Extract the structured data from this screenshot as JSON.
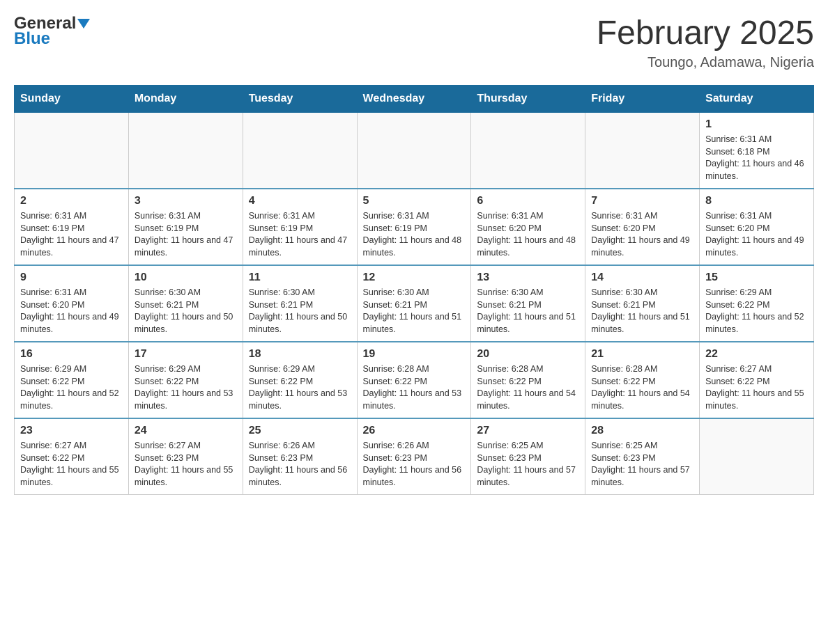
{
  "header": {
    "logo_general": "General",
    "logo_blue": "Blue",
    "month_title": "February 2025",
    "location": "Toungo, Adamawa, Nigeria"
  },
  "weekdays": [
    "Sunday",
    "Monday",
    "Tuesday",
    "Wednesday",
    "Thursday",
    "Friday",
    "Saturday"
  ],
  "weeks": [
    [
      {
        "day": "",
        "sunrise": "",
        "sunset": "",
        "daylight": ""
      },
      {
        "day": "",
        "sunrise": "",
        "sunset": "",
        "daylight": ""
      },
      {
        "day": "",
        "sunrise": "",
        "sunset": "",
        "daylight": ""
      },
      {
        "day": "",
        "sunrise": "",
        "sunset": "",
        "daylight": ""
      },
      {
        "day": "",
        "sunrise": "",
        "sunset": "",
        "daylight": ""
      },
      {
        "day": "",
        "sunrise": "",
        "sunset": "",
        "daylight": ""
      },
      {
        "day": "1",
        "sunrise": "Sunrise: 6:31 AM",
        "sunset": "Sunset: 6:18 PM",
        "daylight": "Daylight: 11 hours and 46 minutes."
      }
    ],
    [
      {
        "day": "2",
        "sunrise": "Sunrise: 6:31 AM",
        "sunset": "Sunset: 6:19 PM",
        "daylight": "Daylight: 11 hours and 47 minutes."
      },
      {
        "day": "3",
        "sunrise": "Sunrise: 6:31 AM",
        "sunset": "Sunset: 6:19 PM",
        "daylight": "Daylight: 11 hours and 47 minutes."
      },
      {
        "day": "4",
        "sunrise": "Sunrise: 6:31 AM",
        "sunset": "Sunset: 6:19 PM",
        "daylight": "Daylight: 11 hours and 47 minutes."
      },
      {
        "day": "5",
        "sunrise": "Sunrise: 6:31 AM",
        "sunset": "Sunset: 6:19 PM",
        "daylight": "Daylight: 11 hours and 48 minutes."
      },
      {
        "day": "6",
        "sunrise": "Sunrise: 6:31 AM",
        "sunset": "Sunset: 6:20 PM",
        "daylight": "Daylight: 11 hours and 48 minutes."
      },
      {
        "day": "7",
        "sunrise": "Sunrise: 6:31 AM",
        "sunset": "Sunset: 6:20 PM",
        "daylight": "Daylight: 11 hours and 49 minutes."
      },
      {
        "day": "8",
        "sunrise": "Sunrise: 6:31 AM",
        "sunset": "Sunset: 6:20 PM",
        "daylight": "Daylight: 11 hours and 49 minutes."
      }
    ],
    [
      {
        "day": "9",
        "sunrise": "Sunrise: 6:31 AM",
        "sunset": "Sunset: 6:20 PM",
        "daylight": "Daylight: 11 hours and 49 minutes."
      },
      {
        "day": "10",
        "sunrise": "Sunrise: 6:30 AM",
        "sunset": "Sunset: 6:21 PM",
        "daylight": "Daylight: 11 hours and 50 minutes."
      },
      {
        "day": "11",
        "sunrise": "Sunrise: 6:30 AM",
        "sunset": "Sunset: 6:21 PM",
        "daylight": "Daylight: 11 hours and 50 minutes."
      },
      {
        "day": "12",
        "sunrise": "Sunrise: 6:30 AM",
        "sunset": "Sunset: 6:21 PM",
        "daylight": "Daylight: 11 hours and 51 minutes."
      },
      {
        "day": "13",
        "sunrise": "Sunrise: 6:30 AM",
        "sunset": "Sunset: 6:21 PM",
        "daylight": "Daylight: 11 hours and 51 minutes."
      },
      {
        "day": "14",
        "sunrise": "Sunrise: 6:30 AM",
        "sunset": "Sunset: 6:21 PM",
        "daylight": "Daylight: 11 hours and 51 minutes."
      },
      {
        "day": "15",
        "sunrise": "Sunrise: 6:29 AM",
        "sunset": "Sunset: 6:22 PM",
        "daylight": "Daylight: 11 hours and 52 minutes."
      }
    ],
    [
      {
        "day": "16",
        "sunrise": "Sunrise: 6:29 AM",
        "sunset": "Sunset: 6:22 PM",
        "daylight": "Daylight: 11 hours and 52 minutes."
      },
      {
        "day": "17",
        "sunrise": "Sunrise: 6:29 AM",
        "sunset": "Sunset: 6:22 PM",
        "daylight": "Daylight: 11 hours and 53 minutes."
      },
      {
        "day": "18",
        "sunrise": "Sunrise: 6:29 AM",
        "sunset": "Sunset: 6:22 PM",
        "daylight": "Daylight: 11 hours and 53 minutes."
      },
      {
        "day": "19",
        "sunrise": "Sunrise: 6:28 AM",
        "sunset": "Sunset: 6:22 PM",
        "daylight": "Daylight: 11 hours and 53 minutes."
      },
      {
        "day": "20",
        "sunrise": "Sunrise: 6:28 AM",
        "sunset": "Sunset: 6:22 PM",
        "daylight": "Daylight: 11 hours and 54 minutes."
      },
      {
        "day": "21",
        "sunrise": "Sunrise: 6:28 AM",
        "sunset": "Sunset: 6:22 PM",
        "daylight": "Daylight: 11 hours and 54 minutes."
      },
      {
        "day": "22",
        "sunrise": "Sunrise: 6:27 AM",
        "sunset": "Sunset: 6:22 PM",
        "daylight": "Daylight: 11 hours and 55 minutes."
      }
    ],
    [
      {
        "day": "23",
        "sunrise": "Sunrise: 6:27 AM",
        "sunset": "Sunset: 6:22 PM",
        "daylight": "Daylight: 11 hours and 55 minutes."
      },
      {
        "day": "24",
        "sunrise": "Sunrise: 6:27 AM",
        "sunset": "Sunset: 6:23 PM",
        "daylight": "Daylight: 11 hours and 55 minutes."
      },
      {
        "day": "25",
        "sunrise": "Sunrise: 6:26 AM",
        "sunset": "Sunset: 6:23 PM",
        "daylight": "Daylight: 11 hours and 56 minutes."
      },
      {
        "day": "26",
        "sunrise": "Sunrise: 6:26 AM",
        "sunset": "Sunset: 6:23 PM",
        "daylight": "Daylight: 11 hours and 56 minutes."
      },
      {
        "day": "27",
        "sunrise": "Sunrise: 6:25 AM",
        "sunset": "Sunset: 6:23 PM",
        "daylight": "Daylight: 11 hours and 57 minutes."
      },
      {
        "day": "28",
        "sunrise": "Sunrise: 6:25 AM",
        "sunset": "Sunset: 6:23 PM",
        "daylight": "Daylight: 11 hours and 57 minutes."
      },
      {
        "day": "",
        "sunrise": "",
        "sunset": "",
        "daylight": ""
      }
    ]
  ]
}
